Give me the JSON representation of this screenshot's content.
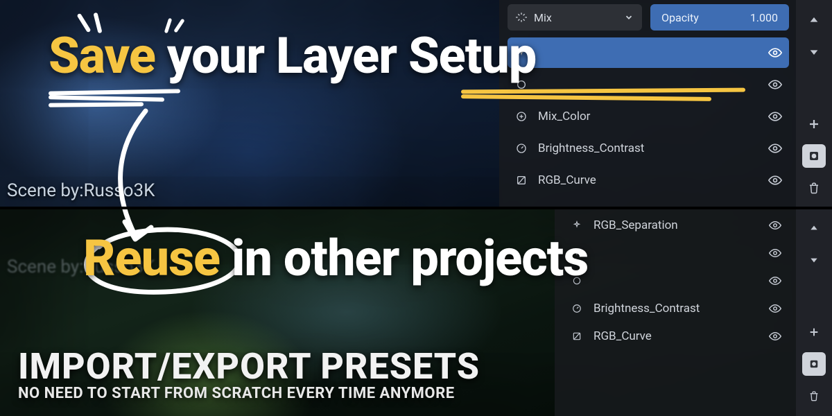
{
  "credit_top": "Scene by:Russo3K",
  "credit_bot": "Scene by:Russo3K",
  "top_panel": {
    "blend_mode": "Mix",
    "opacity_label": "Opacity",
    "opacity_value": "1.000",
    "layers": [
      {
        "icon": "sparkle",
        "name": "",
        "selected": true
      },
      {
        "icon": "circle",
        "name": "",
        "selected": false
      },
      {
        "icon": "plus",
        "name": "Mix_Color",
        "selected": false
      },
      {
        "icon": "dial",
        "name": "Brightness_Contrast",
        "selected": false
      },
      {
        "icon": "curve",
        "name": "RGB_Curve",
        "selected": false
      }
    ],
    "tools": [
      "move-up",
      "move-down",
      "spacer",
      "add",
      "mask",
      "delete"
    ]
  },
  "bot_panel": {
    "layers": [
      {
        "icon": "sparkle",
        "name": "RGB_Separation",
        "selected": false
      },
      {
        "icon": "sparkle",
        "name": "",
        "selected": false
      },
      {
        "icon": "circle",
        "name": "",
        "selected": false
      },
      {
        "icon": "dial",
        "name": "Brightness_Contrast",
        "selected": false
      },
      {
        "icon": "curve",
        "name": "RGB_Curve",
        "selected": false
      }
    ],
    "tools": [
      "move-up",
      "move-down",
      "spacer",
      "add",
      "mask",
      "delete"
    ]
  },
  "headline_top": {
    "accent": "Save",
    "rest": " your Layer Setup"
  },
  "headline_bot": {
    "accent": "Reuse",
    "rest": " in other projects"
  },
  "caption": {
    "big": "IMPORT/EXPORT PRESETS",
    "sub": "NO NEED TO START FROM SCRATCH EVERY TIME ANYMORE"
  },
  "icons": {
    "eye": "eye-icon",
    "chev": "chevron-down-icon"
  }
}
